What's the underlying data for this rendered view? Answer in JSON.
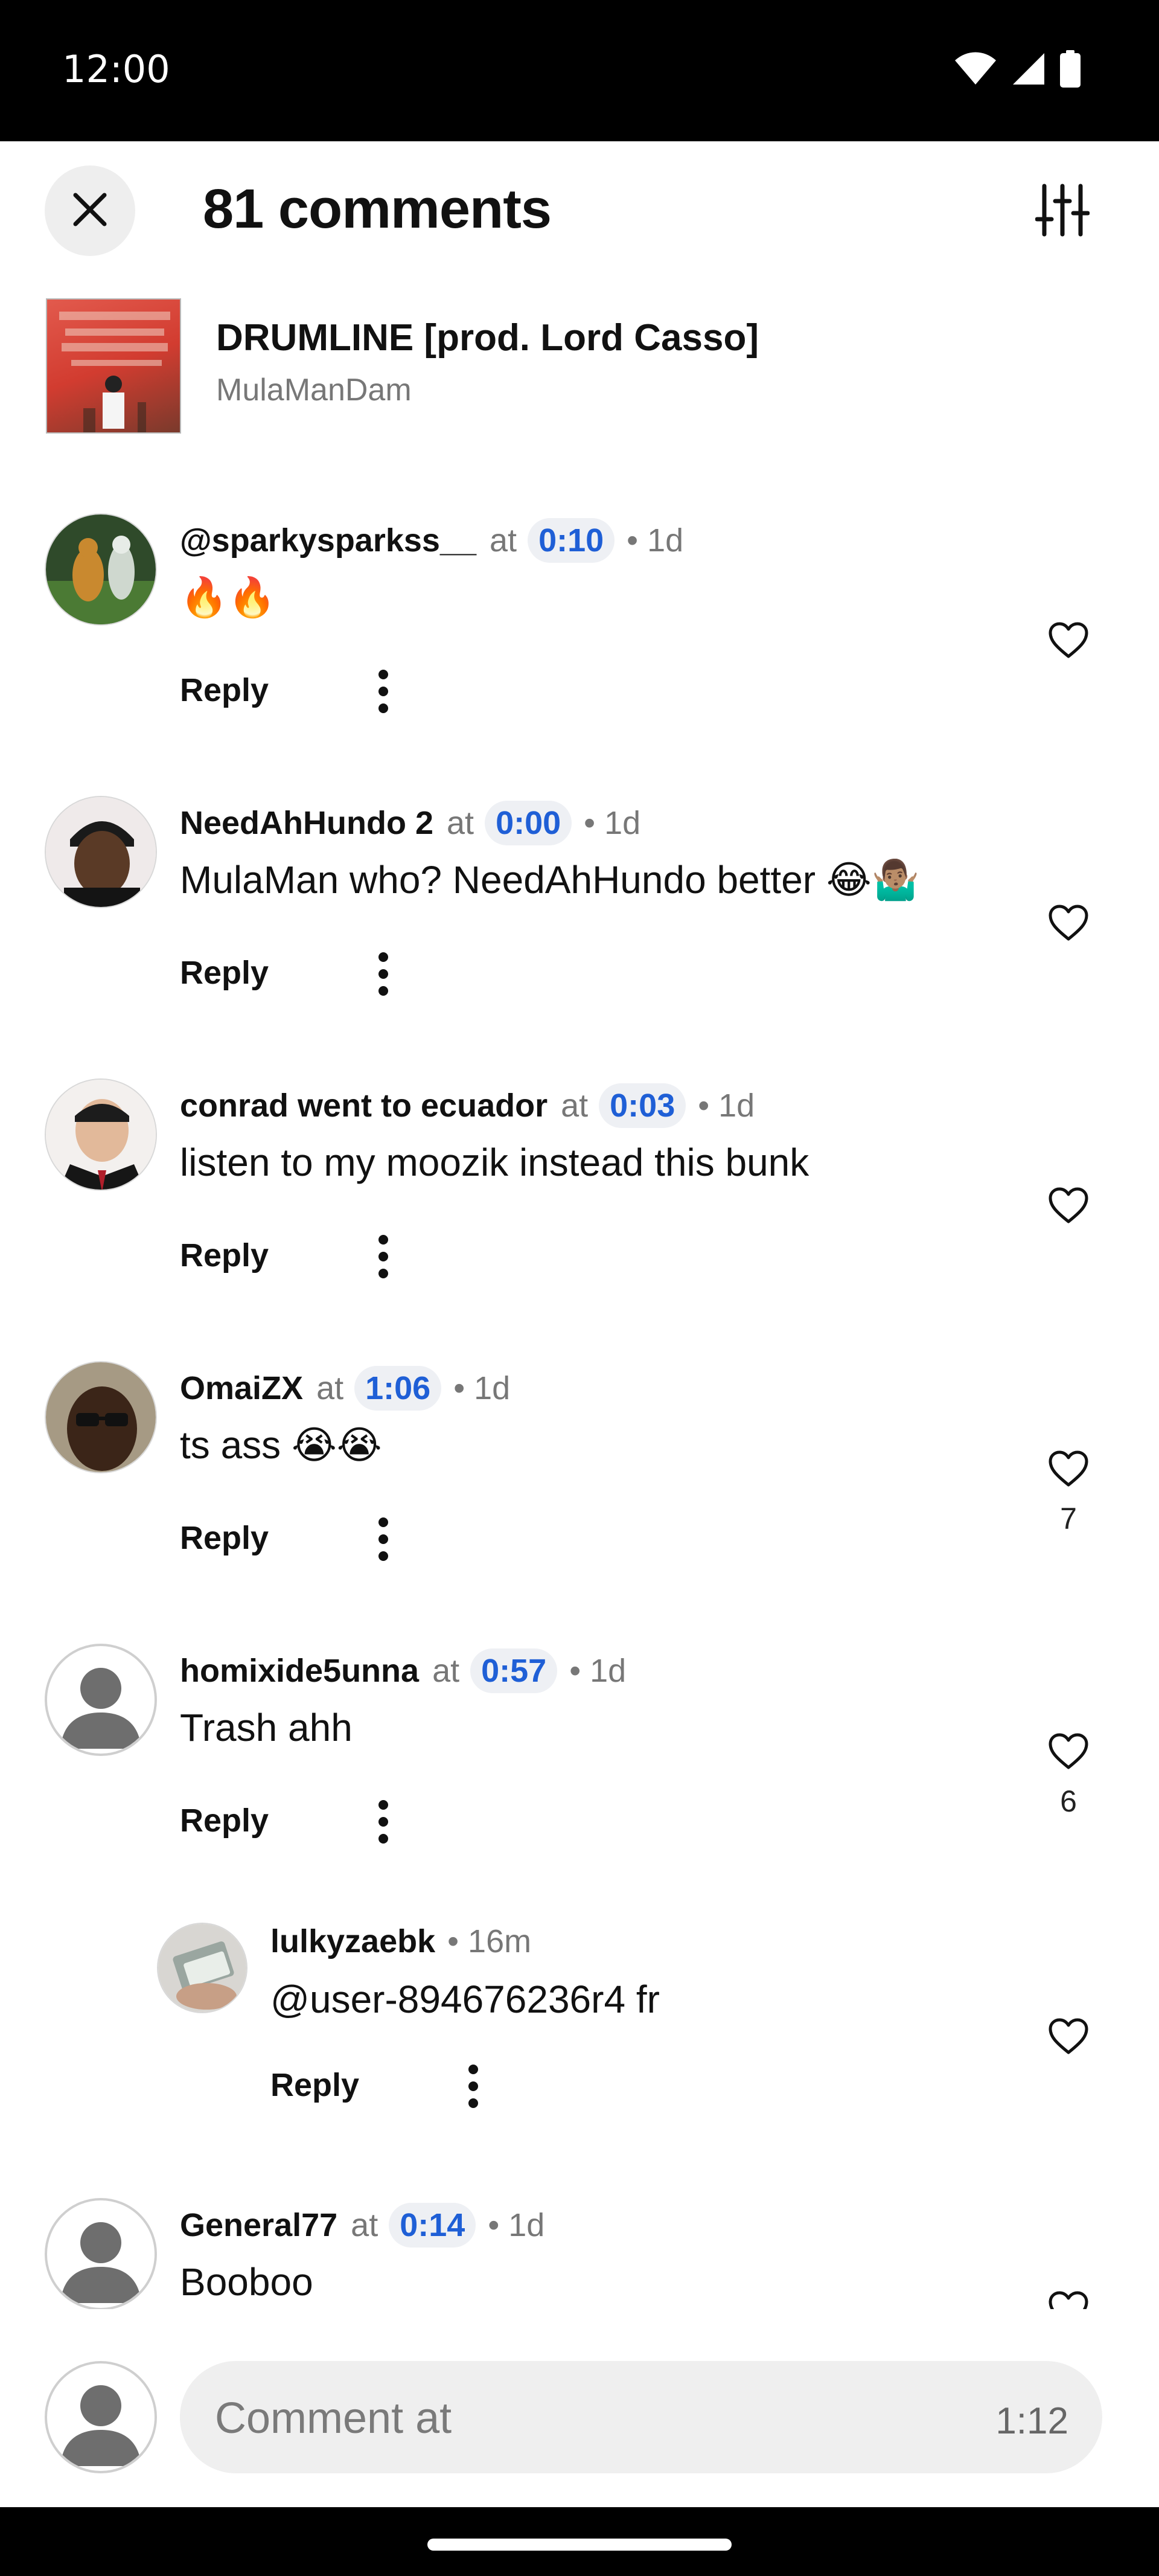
{
  "status_bar": {
    "time": "12:00",
    "icons": [
      "wifi-icon",
      "signal-icon",
      "battery-icon"
    ]
  },
  "header": {
    "title": "81 comments",
    "close_icon": "close-icon",
    "filter_icon": "sliders-icon"
  },
  "track": {
    "title": "DRUMLINE [prod. Lord Casso]",
    "artist": "MulaManDam"
  },
  "labels": {
    "at": "at",
    "reply": "Reply"
  },
  "comments": [
    {
      "user": "@sparkysparkss__",
      "timestamp": "0:10",
      "age": "• 1d",
      "text": "🔥🔥",
      "likes": ""
    },
    {
      "user": "NeedAhHundo 2",
      "timestamp": "0:00",
      "age": "• 1d",
      "text": "MulaMan who? NeedAhHundo better 😂🤷🏽‍♂️",
      "likes": ""
    },
    {
      "user": "conrad went to ecuador",
      "timestamp": "0:03",
      "age": "• 1d",
      "text": "listen to my moozik instead this bunk",
      "likes": ""
    },
    {
      "user": "OmaiZX",
      "timestamp": "1:06",
      "age": "• 1d",
      "text": "ts ass 😭😭",
      "likes": "7"
    },
    {
      "user": "homixide5unna",
      "timestamp": "0:57",
      "age": "• 1d",
      "text": "Trash ahh",
      "likes": "6"
    },
    {
      "user": "lulkyzaebk",
      "timestamp": "",
      "age": "• 16m",
      "text": "@user-894676236r4 fr",
      "likes": "",
      "is_reply": true
    },
    {
      "user": "General77",
      "timestamp": "0:14",
      "age": "• 1d",
      "text": "Booboo",
      "likes": ""
    }
  ],
  "composer": {
    "placeholder": "Comment at",
    "time": "1:12"
  },
  "colors": {
    "timestamp_blue": "#1f5fd6",
    "timestamp_bg": "#eef0f4",
    "muted": "#777777"
  }
}
